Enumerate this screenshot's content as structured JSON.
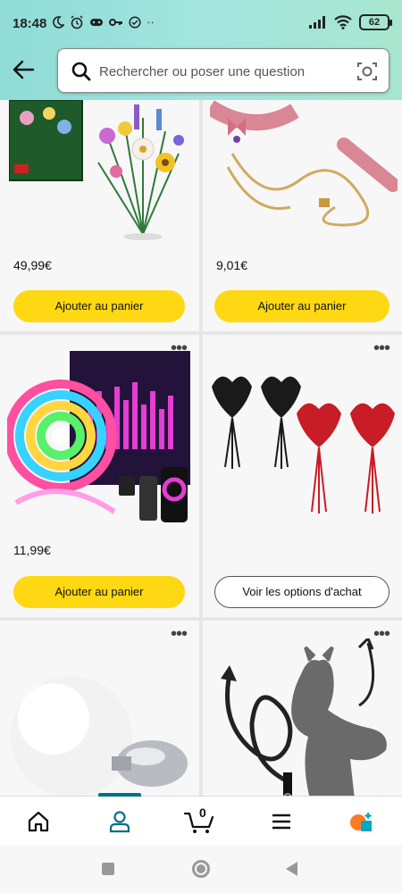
{
  "status_bar": {
    "time": "18:48",
    "notification_icons": [
      "moon-icon",
      "alarm-icon",
      "game-controller-icon",
      "key-icon",
      "check-circle-icon"
    ],
    "overflow": "··",
    "battery": "62"
  },
  "search": {
    "placeholder": "Rechercher ou poser une question"
  },
  "products": [
    {
      "price": "49,99€",
      "button": "Ajouter au panier"
    },
    {
      "price": "9,01€",
      "button": "Ajouter au panier"
    },
    {
      "price": "11,99€",
      "button": "Ajouter au panier"
    },
    {
      "price": "",
      "button": "Voir les options d'achat"
    },
    {
      "price": "",
      "button": ""
    },
    {
      "price": "",
      "button": ""
    }
  ],
  "more_glyph": "•••",
  "bottom_nav": {
    "cart_count": "0",
    "active": "account"
  },
  "colors": {
    "header_gradient_start": "#8fdcd6",
    "add_to_cart": "#ffd814",
    "active_tab": "#007185"
  }
}
